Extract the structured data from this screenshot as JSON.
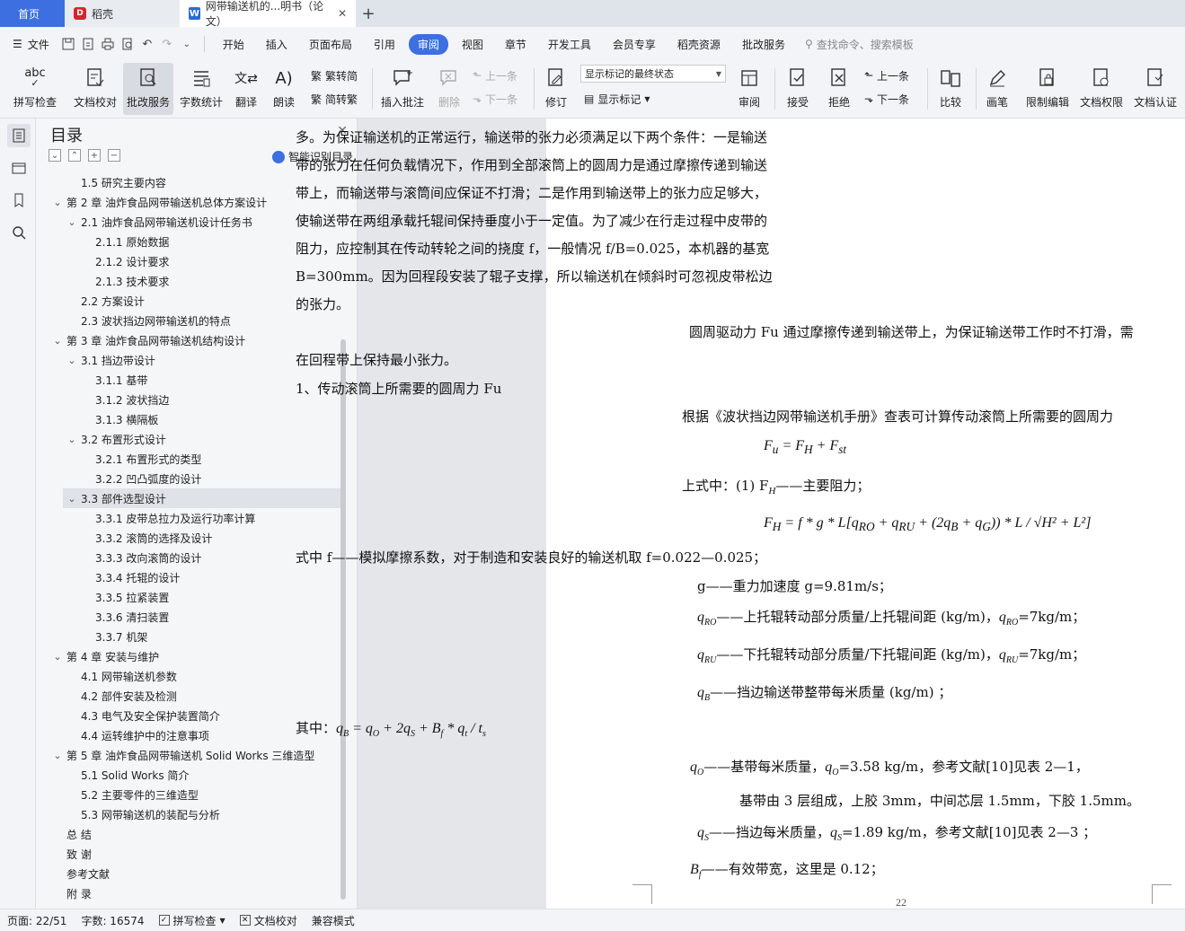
{
  "tabs": {
    "home": "首页",
    "daoke": "稻壳",
    "doc": "网带输送机的...明书（论文）"
  },
  "menu": {
    "file": "文件",
    "items": [
      "开始",
      "插入",
      "页面布局",
      "引用",
      "审阅",
      "视图",
      "章节",
      "开发工具",
      "会员专享",
      "稻壳资源",
      "批改服务"
    ],
    "active": "审阅",
    "search": "查找命令、搜索模板"
  },
  "ribbon": {
    "spell": "拼写检查",
    "proof": "文档校对",
    "review_service": "批改服务",
    "word_count": "字数统计",
    "translate": "翻译",
    "read_aloud": "朗读",
    "to_trad": "繁转简",
    "to_simp": "简转繁",
    "insert_comment": "插入批注",
    "delete": "删除",
    "prev_comment": "上一条",
    "next_comment": "下一条",
    "revise": "修订",
    "markup_state": "显示标记的最终状态",
    "show_markup": "显示标记",
    "review": "审阅",
    "accept": "接受",
    "reject": "拒绝",
    "prev_change": "上一条",
    "next_change": "下一条",
    "compare": "比较",
    "pen": "画笔",
    "restrict": "限制编辑",
    "doc_perm": "文档权限",
    "doc_cert": "文档认证"
  },
  "toc": {
    "title": "目录",
    "smart": "智能识别目录",
    "items": [
      {
        "text": "1.5  研究主要内容",
        "level": 2,
        "chev": ""
      },
      {
        "text": "第 2 章  油炸食品网带输送机总体方案设计",
        "level": 1,
        "chev": "open"
      },
      {
        "text": "2.1  油炸食品网带输送机设计任务书",
        "level": 2,
        "chev": "open"
      },
      {
        "text": "2.1.1 原始数据",
        "level": 3,
        "chev": ""
      },
      {
        "text": "2.1.2 设计要求",
        "level": 3,
        "chev": ""
      },
      {
        "text": "2.1.3 技术要求",
        "level": 3,
        "chev": ""
      },
      {
        "text": "2.2  方案设计",
        "level": 2,
        "chev": ""
      },
      {
        "text": "2.3  波状挡边网带输送机的特点",
        "level": 2,
        "chev": ""
      },
      {
        "text": "第 3 章  油炸食品网带输送机结构设计",
        "level": 1,
        "chev": "open"
      },
      {
        "text": "3.1 挡边带设计",
        "level": 2,
        "chev": "open"
      },
      {
        "text": "3.1.1  基带",
        "level": 3,
        "chev": ""
      },
      {
        "text": "3.1.2  波状挡边",
        "level": 3,
        "chev": ""
      },
      {
        "text": "3.1.3  横隔板",
        "level": 3,
        "chev": ""
      },
      {
        "text": "3.2 布置形式设计",
        "level": 2,
        "chev": "open"
      },
      {
        "text": "3.2.1  布置形式的类型",
        "level": 3,
        "chev": ""
      },
      {
        "text": "3.2.2 凹凸弧度的设计",
        "level": 3,
        "chev": ""
      },
      {
        "text": "3.3 部件选型设计",
        "level": 2,
        "chev": "open",
        "selected": true
      },
      {
        "text": "3.3.1 皮带总拉力及运行功率计算",
        "level": 3,
        "chev": ""
      },
      {
        "text": "3.3.2 滚筒的选择及设计",
        "level": 3,
        "chev": ""
      },
      {
        "text": "3.3.3 改向滚筒的设计",
        "level": 3,
        "chev": ""
      },
      {
        "text": "3.3.4 托辊的设计",
        "level": 3,
        "chev": ""
      },
      {
        "text": "3.3.5 拉紧装置",
        "level": 3,
        "chev": ""
      },
      {
        "text": "3.3.6 清扫装置",
        "level": 3,
        "chev": ""
      },
      {
        "text": "3.3.7 机架",
        "level": 3,
        "chev": ""
      },
      {
        "text": "第 4 章  安装与维护",
        "level": 1,
        "chev": "open"
      },
      {
        "text": "4.1 网带输送机参数",
        "level": 2,
        "chev": ""
      },
      {
        "text": "4.2 部件安装及检测",
        "level": 2,
        "chev": ""
      },
      {
        "text": "4.3 电气及安全保护装置简介",
        "level": 2,
        "chev": ""
      },
      {
        "text": "4.4 运转维护中的注意事项",
        "level": 2,
        "chev": ""
      },
      {
        "text": "第 5 章  油炸食品网带输送机 Solid Works 三维造型",
        "level": 1,
        "chev": "open"
      },
      {
        "text": "5.1 Solid Works 简介",
        "level": 2,
        "chev": ""
      },
      {
        "text": "5.2  主要零件的三维造型",
        "level": 2,
        "chev": ""
      },
      {
        "text": "5.3  网带输送机的装配与分析",
        "level": 2,
        "chev": ""
      },
      {
        "text": "总    结",
        "level": 1,
        "chev": ""
      },
      {
        "text": "致    谢",
        "level": 1,
        "chev": ""
      },
      {
        "text": "参考文献",
        "level": 1,
        "chev": ""
      },
      {
        "text": "附    录",
        "level": 1,
        "chev": ""
      }
    ]
  },
  "doc": {
    "p1": [
      "多。为保证输送机的正常运行，输送带的张力必须满足以下两个条件：一是输送",
      "带的张力在任何负载情况下，作用到全部滚筒上的圆周力是通过摩擦传递到输送",
      "带上，而输送带与滚筒间应保证不打滑；二是作用到输送带上的张力应足够大，",
      "使输送带在两组承载托辊间保持垂度小于一定值。为了减少在行走过程中皮带的",
      "阻力，应控制其在传动转轮之间的挠度 f，一般情况 f/B=0.025，本机器的基宽",
      "B=300mm。因为回程段安装了辊子支撑，所以输送机在倾斜时可忽视皮带松边",
      "的张力。"
    ],
    "p2a": "圆周驱动力 Fu 通过摩擦传递到输送带上，为保证输送带工作时不打滑，需",
    "p2b": "在回程带上保持最小张力。",
    "h1": "1、传动滚筒上所需要的圆周力  Fu",
    "p3": "根据《波状挡边网带输送机手册》查表可计算传动滚筒上所需要的圆周力",
    "f1": "F",
    "f1_u": "u",
    "f1_rest": " = F",
    "f1_h": "H",
    "f1_plus": " + F",
    "f1_st": "st",
    "p4": "上式中：(1)   F",
    "p4_sub": "H",
    "p4_rest": "——主要阻力；",
    "f2": "F",
    "f2_sub": "H",
    "f2_rest": " = f * g * L[q",
    "f2_ro": "RO",
    "f2_mid": " + q",
    "f2_ru": "RU",
    "f2_mid2": " + (2q",
    "f2_b": "B",
    "f2_mid3": " + q",
    "f2_g": "G",
    "f2_end": ")) * L / √H² + L²]",
    "l1": "式中    f——模拟摩擦系数，对于制造和安装良好的输送机取  f=0.022—0.025；",
    "l2": "g——重力加速度 g=9.81m/s；",
    "l3a": "q",
    "l3a_sub": "RO",
    "l3": "——上托辊转动部分质量/上托辊间距    (kg/m)，",
    "l3b_sub": "RO",
    "l3b": "=7kg/m；",
    "l4_sub": "RU",
    "l4": "——下托辊转动部分质量/下托辊间距    (kg/m)，",
    "l4b_sub": "RU",
    "l4b": "=7kg/m；",
    "l5_sub": "B",
    "l5": "——挡边输送带整带每米质量  (kg/m) ；",
    "l6": "其中：",
    "l6f": "q",
    "l6f_b": "B",
    "l6f_rest": " = q",
    "l6f_o": "O",
    "l6f_rest2": " + 2q",
    "l6f_s": "S",
    "l6f_rest3": " + B",
    "l6f_f": "f",
    "l6f_rest4": " * q",
    "l6f_t": "t",
    "l6f_rest5": " / t",
    "l6f_s2": "s",
    "l7_sub": "O",
    "l7": "——基带每米质量，",
    "l7b_sub": "O",
    "l7b": "=3.58 kg/m，参考文献[10]见表  2—1，",
    "l8": "基带由 3 层组成，上胶 3mm，中间芯层 1.5mm，下胶 1.5mm。",
    "l9_sub": "S",
    "l9": "——挡边每米质量，",
    "l9b_sub": "S",
    "l9b": "=1.89 kg/m，参考文献[10]见表  2—3 ；",
    "l10": "B",
    "l10_sub": "f",
    "l10_rest": "——有效带宽，这里是 0.12；",
    "page_number": "22"
  },
  "status": {
    "page": "页面: 22/51",
    "words": "字数: 16574",
    "spell": "拼写检查",
    "proof": "文档校对",
    "compat": "兼容模式"
  }
}
